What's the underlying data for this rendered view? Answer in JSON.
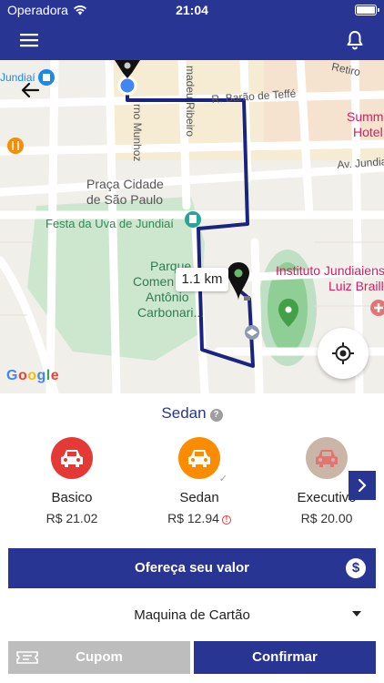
{
  "status_bar": {
    "carrier": "Operadora",
    "time": "21:04",
    "battery_level": 1.0
  },
  "map": {
    "labels": {
      "jundiai": "Jundiaí",
      "munhoz": "rno Munhoz",
      "madeu": "madeu Ribeiro",
      "barao": "R. Barão de Teffé",
      "retiro": "Retiro",
      "summit": "Summ",
      "hotel": "Hotel",
      "av_jundiai": "Av. Jundiaí",
      "praca_line1": "Praça Cidade",
      "praca_line2": "de São Paulo",
      "festa": "Festa da Uva de Jundiaí",
      "parque_line1": "Parque",
      "parque_line2": "Comen",
      "parque_line3": "Antônio",
      "parque_line4": "Carbonari...",
      "instituto_line1": "Instituto Jundiaiens",
      "instituto_line2": "Luiz Braill"
    },
    "distance": "1.1 km",
    "google_logo": "Google"
  },
  "ride": {
    "category": "Sedan",
    "help_symbol": "?",
    "vehicles": [
      {
        "name": "Basico",
        "price": "R$ 21.02",
        "color": "#e53935"
      },
      {
        "name": "Sedan",
        "price": "R$ 12.94",
        "color": "#fb8c00"
      },
      {
        "name": "Executivo",
        "price": "R$ 20.00",
        "color": "#c9b6a6"
      }
    ],
    "selected_check": "✓",
    "info_symbol": "!",
    "offer_label": "Ofereça seu valor",
    "offer_symbol": "$",
    "payment_method": "Maquina de Cartão",
    "coupon_label": "Cupom",
    "confirm_label": "Confirmar"
  },
  "colors": {
    "primary": "#283593",
    "route": "#1a237e",
    "park": "#cde7cf",
    "disabled": "#bdbdbd"
  }
}
